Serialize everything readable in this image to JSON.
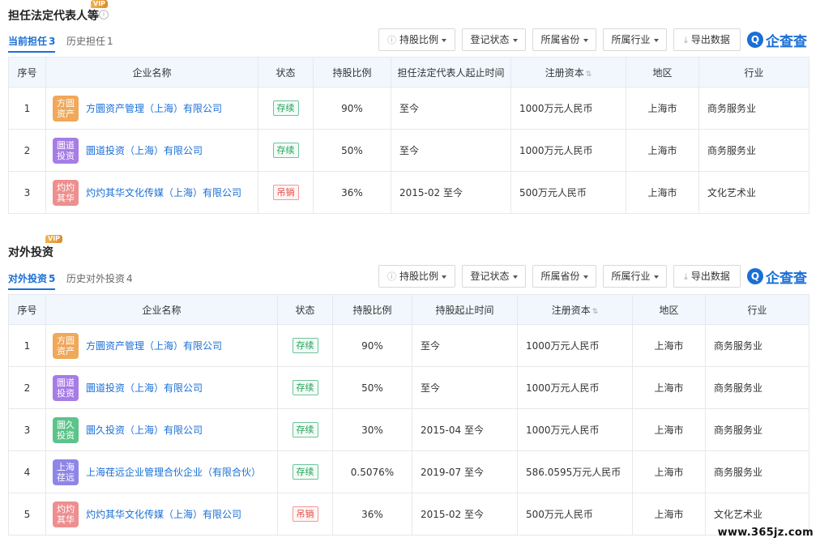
{
  "colors": {
    "accent": "#1a6fd6",
    "header_bg": "#f1f7fd",
    "ok": "#23a05b",
    "bad": "#e1463e"
  },
  "logo_text": "企查查",
  "watermark": "www.365jz.com",
  "legal_rep": {
    "title": "担任法定代表人等",
    "vip": "VIP",
    "tabs": [
      {
        "label": "当前担任",
        "count": "3"
      },
      {
        "label": "历史担任",
        "count": "1"
      }
    ],
    "filters": [
      "持股比例",
      "登记状态",
      "所属省份",
      "所属行业"
    ],
    "export_label": "导出数据",
    "columns": [
      "序号",
      "企业名称",
      "状态",
      "持股比例",
      "担任法定代表人起止时间",
      "注册资本",
      "地区",
      "行业"
    ],
    "rows": [
      {
        "no": "1",
        "avatar": "方圆资产",
        "avatar_color": "#f0a85a",
        "name": "方圜资产管理（上海）有限公司",
        "status": "存续",
        "status_type": "ok",
        "ratio": "90%",
        "period": "至今",
        "capital": "1000万元人民币",
        "region": "上海市",
        "industry": "商务服务业"
      },
      {
        "no": "2",
        "avatar": "圜道投资",
        "avatar_color": "#a77ce6",
        "name": "圜道投资（上海）有限公司",
        "status": "存续",
        "status_type": "ok",
        "ratio": "50%",
        "period": "至今",
        "capital": "1000万元人民币",
        "region": "上海市",
        "industry": "商务服务业"
      },
      {
        "no": "3",
        "avatar": "灼灼其华",
        "avatar_color": "#ee8f8f",
        "name": "灼灼其华文化传媒（上海）有限公司",
        "status": "吊销",
        "status_type": "bad",
        "ratio": "36%",
        "period": "2015-02 至今",
        "capital": "500万元人民币",
        "region": "上海市",
        "industry": "文化艺术业"
      }
    ]
  },
  "investment": {
    "title": "对外投资",
    "vip": "VIP",
    "tabs": [
      {
        "label": "对外投资",
        "count": "5"
      },
      {
        "label": "历史对外投资",
        "count": "4"
      }
    ],
    "filters": [
      "持股比例",
      "登记状态",
      "所属省份",
      "所属行业"
    ],
    "export_label": "导出数据",
    "columns": [
      "序号",
      "企业名称",
      "状态",
      "持股比例",
      "持股起止时间",
      "注册资本",
      "地区",
      "行业"
    ],
    "rows": [
      {
        "no": "1",
        "avatar": "方圆资产",
        "avatar_color": "#f0a85a",
        "name": "方圜资产管理（上海）有限公司",
        "status": "存续",
        "status_type": "ok",
        "ratio": "90%",
        "period": "至今",
        "capital": "1000万元人民币",
        "region": "上海市",
        "industry": "商务服务业"
      },
      {
        "no": "2",
        "avatar": "圜道投资",
        "avatar_color": "#a77ce6",
        "name": "圜道投资（上海）有限公司",
        "status": "存续",
        "status_type": "ok",
        "ratio": "50%",
        "period": "至今",
        "capital": "1000万元人民币",
        "region": "上海市",
        "industry": "商务服务业"
      },
      {
        "no": "3",
        "avatar": "圜久投资",
        "avatar_color": "#5cc48a",
        "name": "圜久投资（上海）有限公司",
        "status": "存续",
        "status_type": "ok",
        "ratio": "30%",
        "period": "2015-04 至今",
        "capital": "1000万元人民币",
        "region": "上海市",
        "industry": "商务服务业"
      },
      {
        "no": "4",
        "avatar": "上海荏远",
        "avatar_color": "#8e86e6",
        "name": "上海荏远企业管理合伙企业（有限合伙）",
        "status": "存续",
        "status_type": "ok",
        "ratio": "0.5076%",
        "period": "2019-07 至今",
        "capital": "586.0595万元人民币",
        "region": "上海市",
        "industry": "商务服务业"
      },
      {
        "no": "5",
        "avatar": "灼灼其华",
        "avatar_color": "#ee8f8f",
        "name": "灼灼其华文化传媒（上海）有限公司",
        "status": "吊销",
        "status_type": "bad",
        "ratio": "36%",
        "period": "2015-02 至今",
        "capital": "500万元人民币",
        "region": "上海市",
        "industry": "文化艺术业"
      }
    ]
  }
}
